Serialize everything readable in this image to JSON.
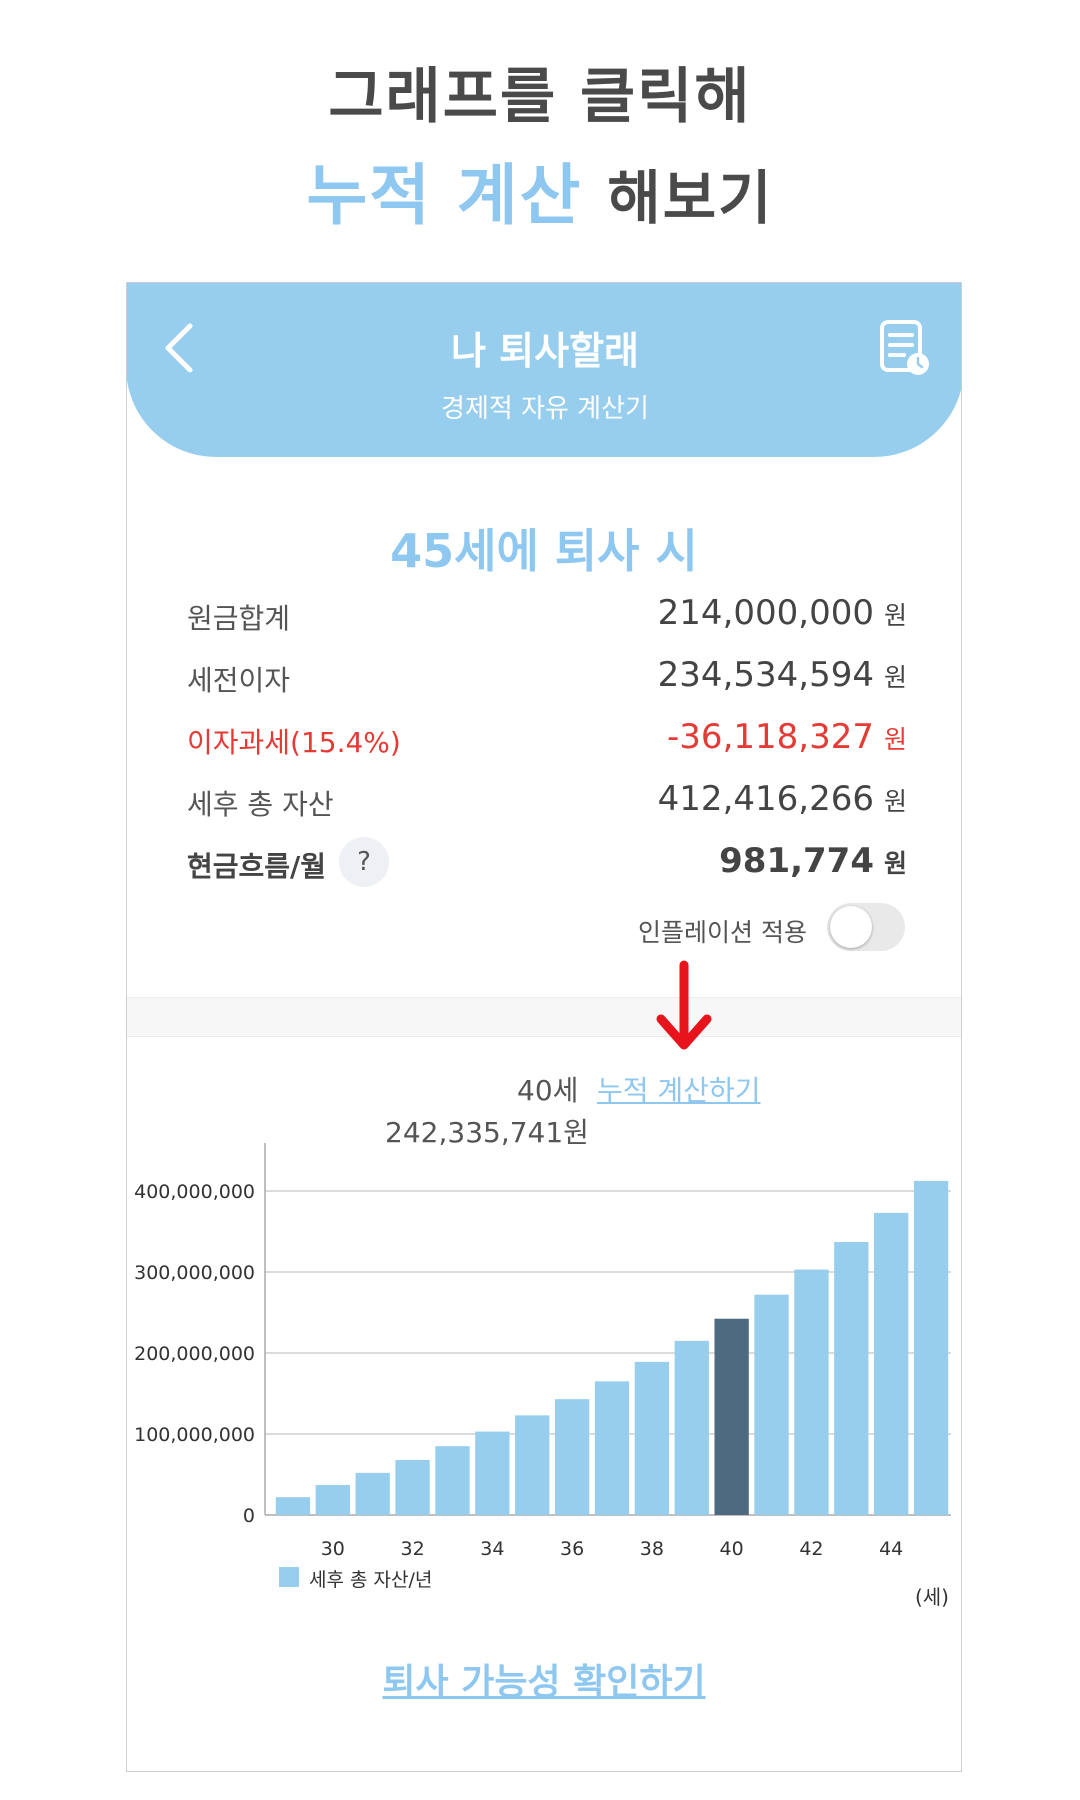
{
  "promo": {
    "line1": "그래프를 클릭해",
    "line2_highlight": "누적 계산",
    "line2_rest": "해보기"
  },
  "header": {
    "back_icon": "chevron-left-icon",
    "title": "나 퇴사할래",
    "subtitle": "경제적 자유 계산기",
    "history_icon": "history-list-icon"
  },
  "result": {
    "title": "45세에 퇴사 시",
    "rows": [
      {
        "label": "원금합계",
        "value": "214,000,000",
        "unit": "원"
      },
      {
        "label": "세전이자",
        "value": "234,534,594",
        "unit": "원"
      },
      {
        "label": "이자과세(15.4%)",
        "value": "-36,118,327",
        "unit": "원"
      },
      {
        "label": "세후 총 자산",
        "value": "412,416,266",
        "unit": "원"
      },
      {
        "label": "현금흐름/월",
        "value": "981,774",
        "unit": "원"
      }
    ],
    "help_label": "?",
    "inflation_label": "인플레이션 적용",
    "inflation_on": false
  },
  "selection": {
    "age": "40세",
    "link": "누적 계산하기",
    "value": "242,335,741원"
  },
  "chart_data": {
    "type": "bar",
    "x": [
      29,
      30,
      31,
      32,
      33,
      34,
      35,
      36,
      37,
      38,
      39,
      40,
      41,
      42,
      43,
      44,
      45
    ],
    "x_tick_labels": [
      "30",
      "32",
      "34",
      "36",
      "38",
      "40",
      "42",
      "44"
    ],
    "values": [
      22000000,
      37000000,
      52000000,
      68000000,
      85000000,
      103000000,
      123000000,
      143000000,
      165000000,
      189000000,
      215000000,
      242335741,
      272000000,
      303000000,
      337000000,
      373000000,
      412416266
    ],
    "y_tick_labels": [
      "0",
      "100,000,000",
      "200,000,000",
      "300,000,000",
      "400,000,000"
    ],
    "ylim": [
      0,
      400000000
    ],
    "selected_x": 40,
    "legend": "세후 총 자산/년",
    "unit_label": "(세)",
    "colors": {
      "bar": "#97ceee",
      "selected": "#4d6a80"
    },
    "grid": true
  },
  "footer": {
    "check_label": "퇴사 가능성 확인하기"
  },
  "colors": {
    "accent": "#8ec7ef",
    "header_bg": "#97ceee",
    "negative": "#e53a35",
    "arrow": "#e8141b"
  }
}
